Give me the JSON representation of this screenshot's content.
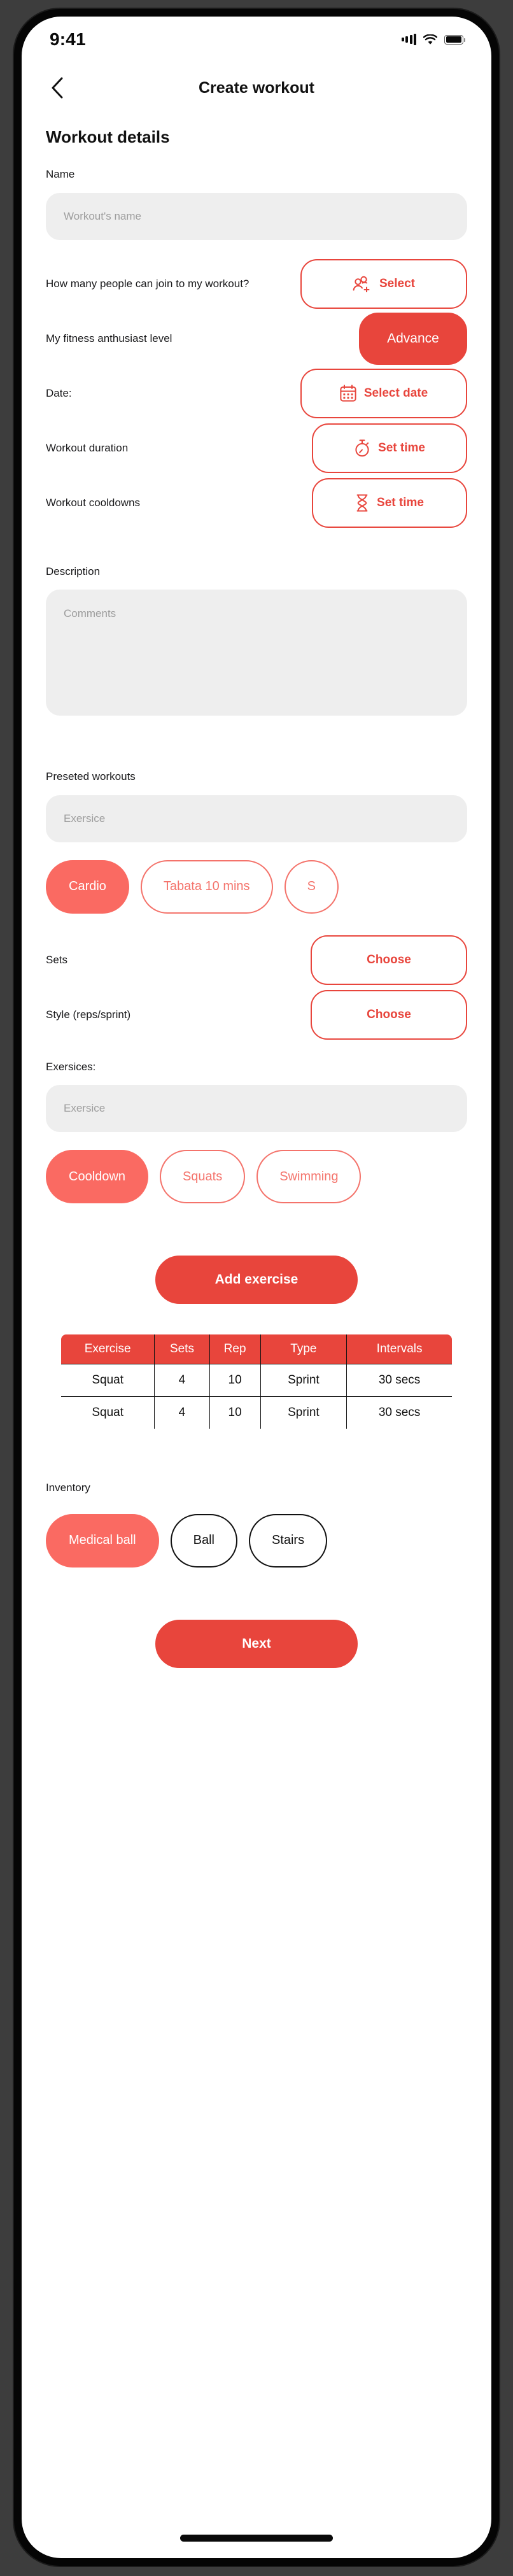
{
  "status_bar": {
    "time": "9:41",
    "icons": [
      "cellular-signal-icon",
      "wifi-icon",
      "battery-icon"
    ]
  },
  "nav": {
    "back_icon": "chevron-left-icon",
    "title": "Create workout"
  },
  "main": {
    "section_title": "Workout details",
    "name": {
      "label": "Name",
      "placeholder": "Workout's name",
      "value": ""
    },
    "participants": {
      "label": "How many people can join to my workout?",
      "button_label": "Select",
      "button_icon": "add-people-icon"
    },
    "fitness_level": {
      "label": "My fitness anthusiast level",
      "button_label": "Advance"
    },
    "date": {
      "label": "Date:",
      "button_label": "Select date",
      "button_icon": "calendar-icon"
    },
    "duration": {
      "label": "Workout duration",
      "button_label": "Set time",
      "button_icon": "stopwatch-icon"
    },
    "cooldowns": {
      "label": "Workout cooldowns",
      "button_label": "Set time",
      "button_icon": "hourglass-icon"
    },
    "description": {
      "label": "Description",
      "placeholder": "Comments",
      "value": ""
    },
    "preseted_workouts": {
      "label": "Preseted workouts",
      "placeholder": "Exersice",
      "value": "",
      "chips": [
        {
          "label": "Cardio",
          "selected": true
        },
        {
          "label": "Tabata 10 mins",
          "selected": false
        },
        {
          "label": "S",
          "selected": false
        }
      ]
    },
    "sets": {
      "label": "Sets",
      "button_label": "Choose"
    },
    "style": {
      "label": "Style (reps/sprint)",
      "button_label": "Choose"
    },
    "exersices": {
      "label": "Exersices:",
      "placeholder": "Exersice",
      "value": "",
      "chips": [
        {
          "label": "Cooldown",
          "selected": true
        },
        {
          "label": "Squats",
          "selected": false
        },
        {
          "label": "Swimming",
          "selected": false
        }
      ]
    },
    "add_exercise_button": "Add exercise",
    "exercise_table": {
      "columns": [
        "Exercise",
        "Sets",
        "Rep",
        "Type",
        "Intervals"
      ],
      "rows": [
        [
          "Squat",
          "4",
          "10",
          "Sprint",
          "30 secs"
        ],
        [
          "Squat",
          "4",
          "10",
          "Sprint",
          "30 secs"
        ]
      ]
    },
    "inventory": {
      "label": "Inventory",
      "chips": [
        {
          "label": "Medical ball",
          "selected": true
        },
        {
          "label": "Ball",
          "selected": false
        },
        {
          "label": "Stairs",
          "selected": false
        }
      ]
    },
    "next_button": "Next"
  },
  "colors": {
    "accent": "#e8453c",
    "accent_light": "#fa6a62",
    "chip_border": "#f4736b",
    "input_bg": "#eeeeee",
    "text": "#111111"
  }
}
